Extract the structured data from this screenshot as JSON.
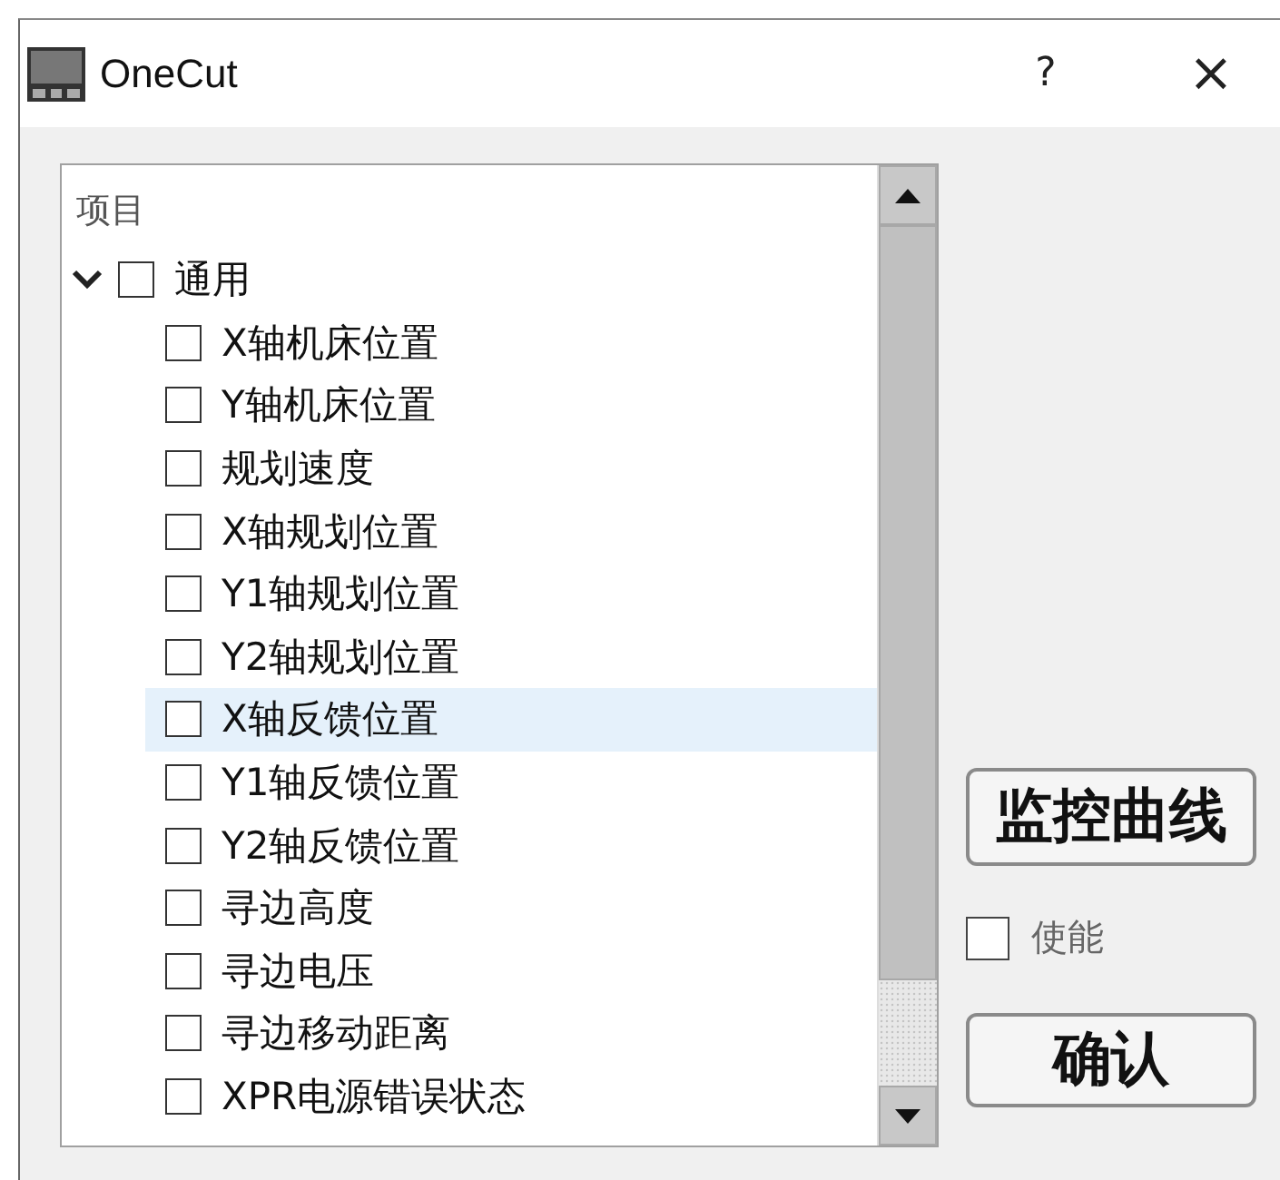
{
  "window": {
    "title": "OneCut",
    "help": "?",
    "close": "×"
  },
  "tree": {
    "header": "项目",
    "items": [
      {
        "label": "通用",
        "expanded": true,
        "checked": false,
        "children": [
          {
            "label": "X轴机床位置",
            "checked": false,
            "highlighted": false
          },
          {
            "label": "Y轴机床位置",
            "checked": false,
            "highlighted": false
          },
          {
            "label": "规划速度",
            "checked": false,
            "highlighted": false
          },
          {
            "label": "X轴规划位置",
            "checked": false,
            "highlighted": false
          },
          {
            "label": "Y1轴规划位置",
            "checked": false,
            "highlighted": false
          },
          {
            "label": "Y2轴规划位置",
            "checked": false,
            "highlighted": false
          },
          {
            "label": "X轴反馈位置",
            "checked": false,
            "highlighted": true
          },
          {
            "label": "Y1轴反馈位置",
            "checked": false,
            "highlighted": false
          },
          {
            "label": "Y2轴反馈位置",
            "checked": false,
            "highlighted": false
          },
          {
            "label": "寻边高度",
            "checked": false,
            "highlighted": false
          },
          {
            "label": "寻边电压",
            "checked": false,
            "highlighted": false
          },
          {
            "label": "寻边移动距离",
            "checked": false,
            "highlighted": false
          },
          {
            "label": "XPR电源错误状态",
            "checked": false,
            "highlighted": false
          }
        ]
      }
    ]
  },
  "monitor_button": "监控曲线",
  "enable": {
    "label": "使能",
    "checked": false
  },
  "confirm_button": "确认"
}
